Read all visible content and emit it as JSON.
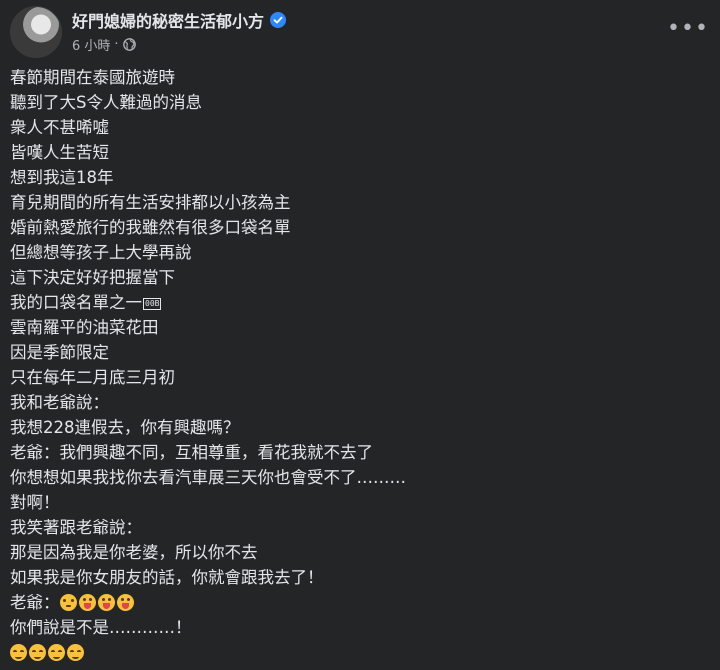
{
  "post": {
    "author": "好門媳婦的秘密生活郁小方",
    "time": "6 小時",
    "separator": "·",
    "lines": [
      "春節期間在泰國旅遊時",
      "聽到了大S令人難過的消息",
      "衆人不甚唏噓",
      "皆嘆人生苦短",
      "想到我這18年",
      "育兒期間的所有生活安排都以小孩為主",
      "婚前熱愛旅行的我雖然有很多口袋名單",
      "但總想等孩子上大學再說",
      "這下決定好好把握當下",
      "我的口袋名單之一",
      "雲南羅平的油菜花田",
      "因是季節限定",
      "只在每年二月底三月初",
      "我和老爺說：",
      "我想228連假去，你有興趣嗎？",
      "老爺：我們興趣不同，互相尊重，看花我就不去了",
      "你想想如果我找你去看汽車展三天你也會受不了………",
      "對啊！",
      "我笑著跟老爺說：",
      "那是因為我是你老婆，所以你不去",
      "如果我是你女朋友的話，你就會跟我去了！",
      "老爺：",
      "你們說是不是…………！"
    ],
    "replacement_glyph": "00B",
    "icons": {
      "verified": "verified-badge-icon",
      "audience": "globe-icon",
      "more": "more-options-icon",
      "emoji_flushed": "flushed-face-emoji",
      "emoji_tongue": "tongue-face-emoji",
      "emoji_relieved": "relieved-face-emoji"
    },
    "colors": {
      "background": "#242526",
      "text": "#e4e6eb",
      "secondary": "#b0b3b8",
      "verified": "#2d88ff"
    }
  }
}
